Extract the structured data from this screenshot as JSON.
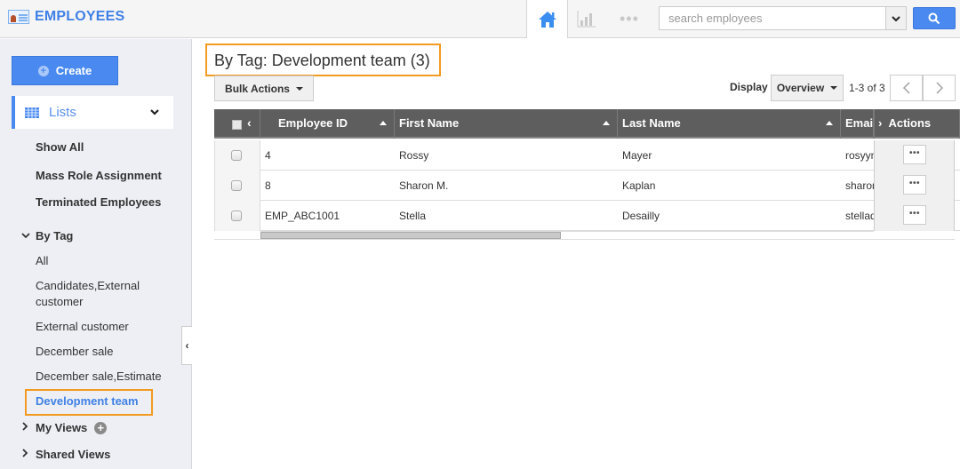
{
  "app": {
    "title": "EMPLOYEES",
    "brand_color": "#3f80e6",
    "accent_color": "#4a8af0",
    "highlight_color": "#f39a21"
  },
  "topbar": {
    "nav": [
      {
        "icon": "home-icon",
        "label": "Home",
        "active": true
      },
      {
        "icon": "bar-chart-icon",
        "label": "Reports",
        "active": false
      },
      {
        "icon": "more-icon",
        "label": "More",
        "active": false
      }
    ],
    "search": {
      "placeholder": "search employees",
      "value": ""
    }
  },
  "sidebar": {
    "create_label": "Create",
    "lists_label": "Lists",
    "items": [
      {
        "label": "Show All"
      },
      {
        "label": "Mass Role Assignment"
      },
      {
        "label": "Terminated Employees"
      }
    ],
    "by_tag": {
      "label": "By Tag",
      "expanded": true,
      "items": [
        {
          "label": "All"
        },
        {
          "label": "Candidates,External customer"
        },
        {
          "label": "External customer"
        },
        {
          "label": "December sale"
        },
        {
          "label": "December sale,Estimate"
        },
        {
          "label": "Development team",
          "active": true
        }
      ]
    },
    "my_views_label": "My Views",
    "shared_views_label": "Shared Views"
  },
  "main": {
    "page_title": "By Tag: Development team (3)",
    "bulk_actions_label": "Bulk Actions",
    "display_label": "Display",
    "display_value": "Overview",
    "pager_text": "1-3 of 3",
    "table": {
      "columns": [
        "Employee ID",
        "First Name",
        "Last Name",
        "Emai",
        "Actions"
      ],
      "rows": [
        {
          "id": "4",
          "first": "Rossy",
          "last": "Mayer",
          "email": "rosyym"
        },
        {
          "id": "8",
          "first": "Sharon M.",
          "last": "Kaplan",
          "email": "sharon"
        },
        {
          "id": "EMP_ABC1001",
          "first": "Stella",
          "last": "Desailly",
          "email": "stellad"
        }
      ],
      "row_action_label": "•••"
    }
  }
}
